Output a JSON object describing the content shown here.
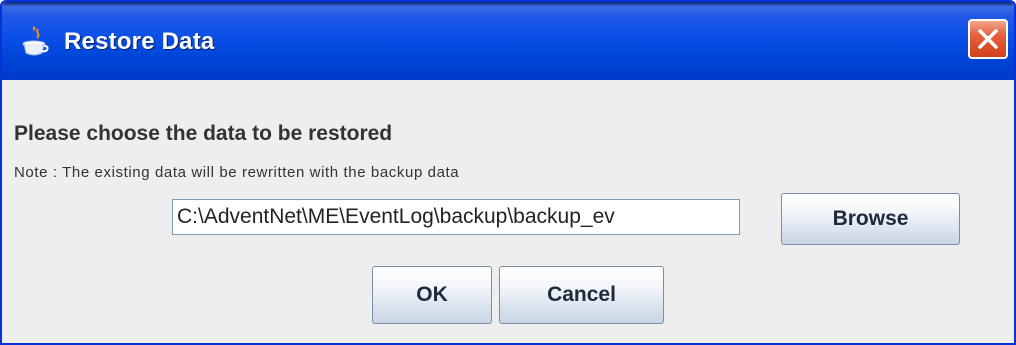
{
  "window": {
    "title": "Restore Data",
    "app_icon": "java-cup-icon",
    "close_icon": "close-icon"
  },
  "dialog": {
    "heading": "Please choose the data to be restored",
    "note": "Note : The existing data will be rewritten with the backup data",
    "path_value": "C:\\AdventNet\\ME\\EventLog\\backup\\backup_ev",
    "browse_label": "Browse",
    "ok_label": "OK",
    "cancel_label": "Cancel"
  },
  "colors": {
    "titlebar": "#0a50e6",
    "close_button": "#e5603c",
    "background": "#eeeeee"
  }
}
